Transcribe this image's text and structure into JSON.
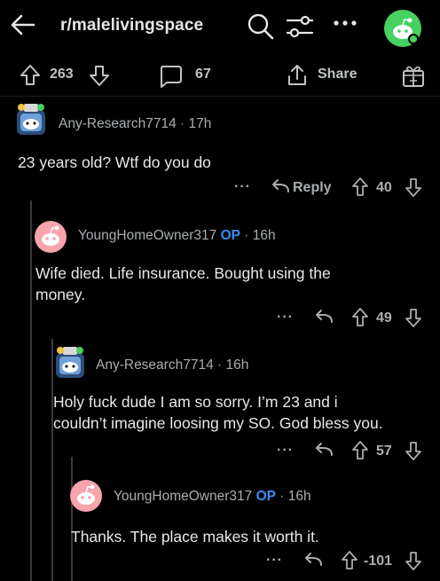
{
  "header": {
    "subreddit": "r/malelivingspace"
  },
  "post_actions": {
    "upvotes": "263",
    "comments": "67",
    "share_label": "Share"
  },
  "comments": [
    {
      "author": "Any-Research7714",
      "op_badge": "",
      "time": "17h",
      "text": "23 years old? Wtf do you do",
      "reply_label": "Reply",
      "score": "40"
    },
    {
      "author": "YoungHomeOwner317",
      "op_badge": "OP",
      "time": "16h",
      "text_lines": [
        "Wife died. Life insurance. Bought using the",
        "money."
      ],
      "score": "49"
    },
    {
      "author": "Any-Research7714",
      "op_badge": "",
      "time": "16h",
      "text_lines": [
        "Holy fuck dude I am so sorry. I’m 23 and i",
        "couldn’t imagine loosing my SO. God bless you."
      ],
      "score": "57"
    },
    {
      "author": "YoungHomeOwner317",
      "op_badge": "OP",
      "time": "16h",
      "text": "Thanks. The place makes it worth it.",
      "score": "-101"
    }
  ],
  "icons": {
    "back": "back-arrow-icon",
    "search": "search-icon",
    "filter": "sort-filter-icon",
    "more": "more-options-icon",
    "avatar": "user-avatar",
    "upvote": "upvote-arrow-icon",
    "downvote": "downvote-arrow-icon",
    "comment": "comment-bubble-icon",
    "share": "share-icon",
    "award": "award-gift-icon",
    "reply": "reply-arrow-icon"
  },
  "colors": {
    "background": "#000000",
    "op_badge": "#3d8df5",
    "avatar_green": "#46d160",
    "snoo_pink": "#f8a4ad"
  },
  "separator": "·",
  "ellipsis": "···"
}
